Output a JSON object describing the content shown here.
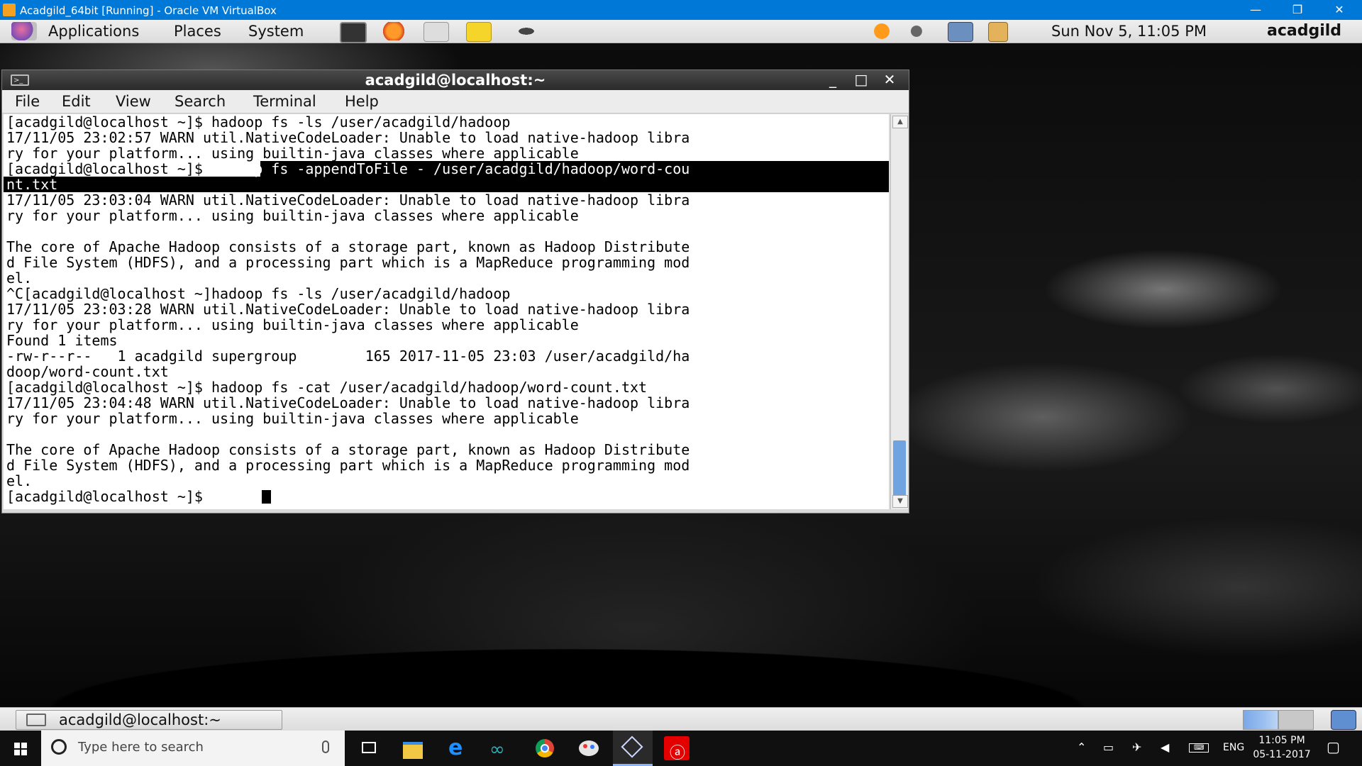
{
  "host_window": {
    "title": "Acadgild_64bit [Running] - Oracle VM VirtualBox",
    "minimize": "—",
    "restore": "❐",
    "close": "✕"
  },
  "gnome_panel": {
    "menus": [
      "Applications",
      "Places",
      "System"
    ],
    "clock": "Sun Nov  5, 11:05 PM",
    "user": "acadgild",
    "launcher_icons": [
      "terminal-icon",
      "firefox-icon",
      "mail-icon",
      "notes-icon",
      "dolphin-icon"
    ],
    "tray_icons": [
      "updates-icon",
      "volume-icon",
      "network-icon",
      "clipboard-icon"
    ]
  },
  "terminal": {
    "title": "acadgild@localhost:~",
    "menus": [
      "File",
      "Edit",
      "View",
      "Search",
      "Terminal",
      "Help"
    ],
    "lines": [
      "[acadgild@localhost ~]$ hadoop fs -ls /user/acadgild/hadoop",
      "17/11/05 23:02:57 WARN util.NativeCodeLoader: Unable to load native-hadoop libra",
      "ry for your platform... using builtin-java classes where applicable",
      "[acadgild@localhost ~]$ hadoop fs -appendToFile - /user/acadgild/hadoop/word-cou",
      "nt.txt",
      "17/11/05 23:03:04 WARN util.NativeCodeLoader: Unable to load native-hadoop libra",
      "ry for your platform... using builtin-java classes where applicable",
      "",
      "The core of Apache Hadoop consists of a storage part, known as Hadoop Distribute",
      "d File System (HDFS), and a processing part which is a MapReduce programming mod",
      "el.",
      "^C[acadgild@localhost ~]hadoop fs -ls /user/acadgild/hadoop",
      "17/11/05 23:03:28 WARN util.NativeCodeLoader: Unable to load native-hadoop libra",
      "ry for your platform... using builtin-java classes where applicable",
      "Found 1 items",
      "-rw-r--r--   1 acadgild supergroup        165 2017-11-05 23:03 /user/acadgild/ha",
      "doop/word-count.txt",
      "[acadgild@localhost ~]$ hadoop fs -cat /user/acadgild/hadoop/word-count.txt",
      "17/11/05 23:04:48 WARN util.NativeCodeLoader: Unable to load native-hadoop libra",
      "ry for your platform... using builtin-java classes where applicable",
      "",
      "The core of Apache Hadoop consists of a storage part, known as Hadoop Distribute",
      "d File System (HDFS), and a processing part which is a MapReduce programming mod",
      "el.",
      "[acadgild@localhost ~]$ "
    ]
  },
  "bottom_panel": {
    "task_label": "acadgild@localhost:~"
  },
  "windows_taskbar": {
    "search_placeholder": "Type here to search",
    "apps": [
      "task-view-icon",
      "file-explorer-icon",
      "edge-icon",
      "arduino-icon",
      "chrome-icon",
      "paint-icon",
      "virtualbox-icon",
      "airtel-icon"
    ],
    "tray": {
      "language": "ENG",
      "time": "11:05 PM",
      "date": "05-11-2017"
    }
  },
  "colors": {
    "windows_titlebar": "#0078d7",
    "selection": "#000000",
    "scroll_thumb": "#6fa4e0"
  }
}
